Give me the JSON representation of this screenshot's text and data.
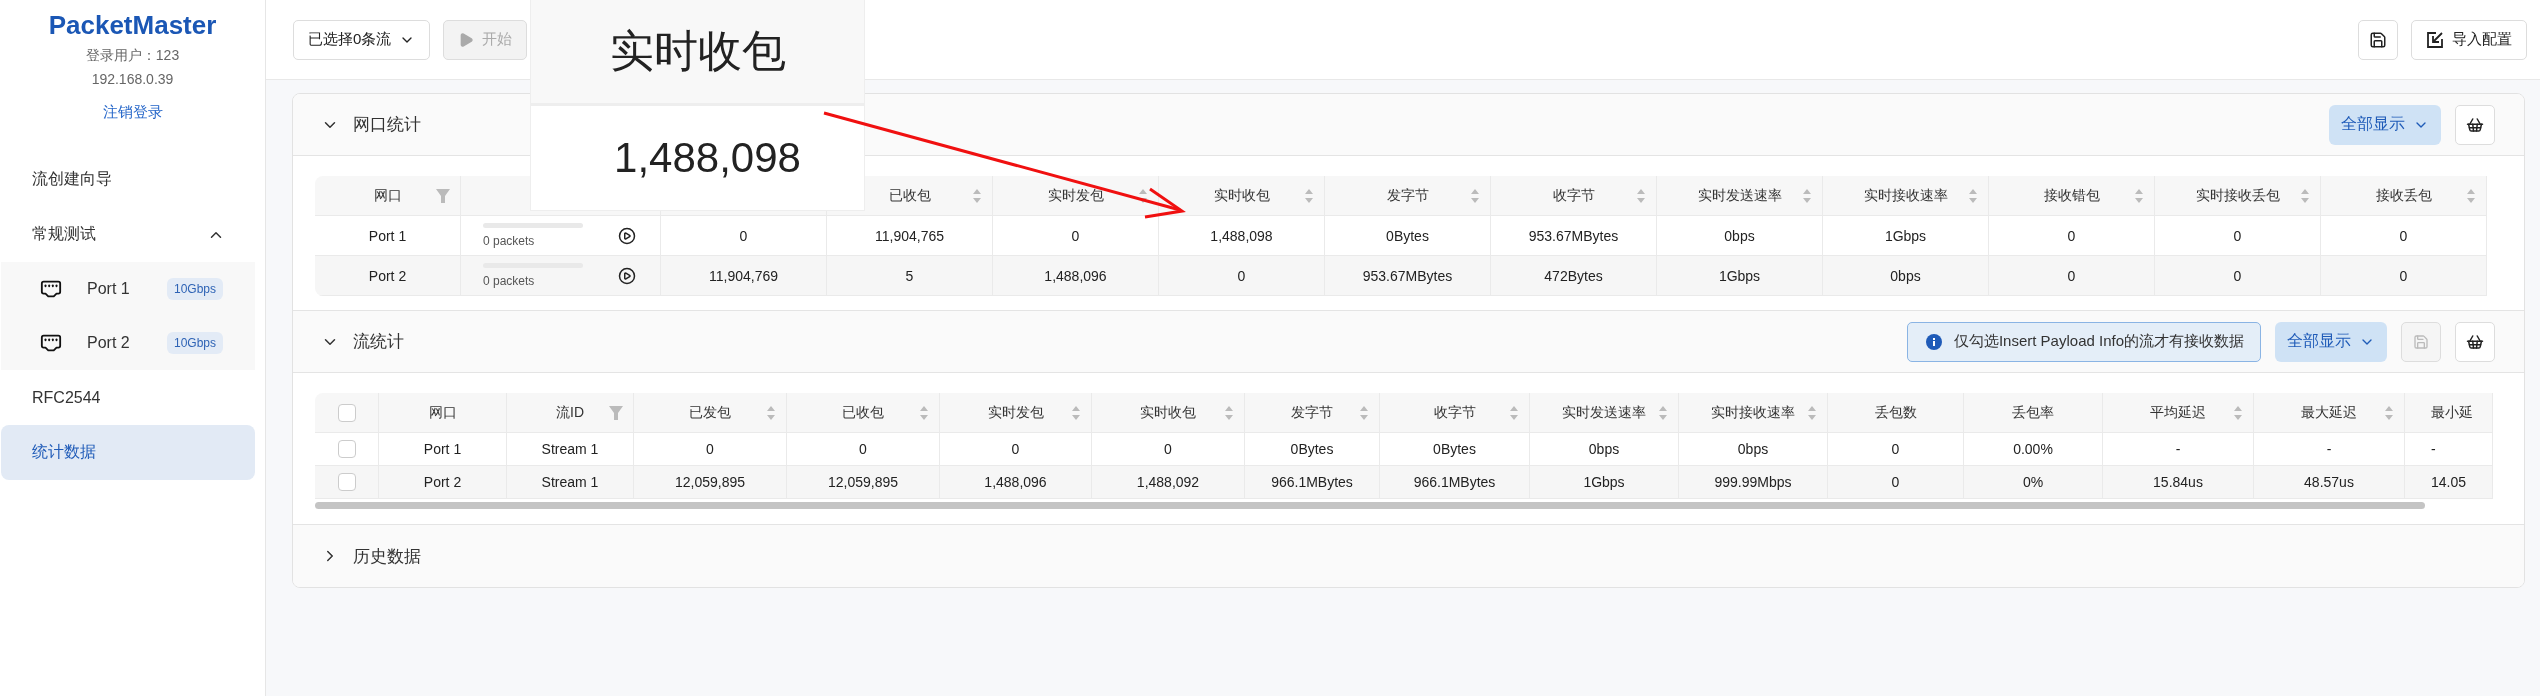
{
  "sidebar": {
    "brand": "PacketMaster",
    "user": "登录用户：123",
    "ip": "192.168.0.39",
    "logout": "注销登录",
    "nav": [
      {
        "kind": "item",
        "label": "流创建向导",
        "selected": false
      },
      {
        "kind": "group",
        "label": "常规测试",
        "selected": false,
        "expanded": true,
        "children": [
          {
            "label": "Port 1",
            "badge": "10Gbps",
            "selected": false
          },
          {
            "label": "Port 2",
            "badge": "10Gbps",
            "selected": false
          }
        ]
      },
      {
        "kind": "item",
        "label": "RFC2544",
        "selected": false
      },
      {
        "kind": "item",
        "label": "统计数据",
        "selected": true
      }
    ]
  },
  "toolbar": {
    "stream_select": "已选择0条流",
    "start": {
      "label": "开始",
      "disabled": true
    },
    "import": "导入配置"
  },
  "port_stats": {
    "title": "网口统计",
    "expanded": true,
    "display_filter": "全部显示",
    "columns": [
      {
        "label": "网口",
        "filter": true
      },
      {},
      {},
      {
        "label": "已收包",
        "sort": true
      },
      {
        "label": "实时发包",
        "sort": true
      },
      {
        "label": "实时收包",
        "sort": true
      },
      {
        "label": "发字节",
        "sort": true
      },
      {
        "label": "收字节",
        "sort": true
      },
      {
        "label": "实时发送速率",
        "sort": true
      },
      {
        "label": "实时接收速率",
        "sort": true
      },
      {
        "label": "接收错包",
        "sort": true
      },
      {
        "label": "实时接收丢包",
        "sort": true
      },
      {
        "label": "接收丢包",
        "sort": true
      }
    ],
    "rows": [
      {
        "port": "Port 1",
        "progress": {
          "level": 0,
          "label": "0 packets"
        },
        "values": [
          "0",
          "11,904,765",
          "0",
          "1,488,098",
          "0Bytes",
          "953.67MBytes",
          "0bps",
          "1Gbps",
          "0",
          "0",
          "0"
        ]
      },
      {
        "port": "Port 2",
        "progress": {
          "level": 0,
          "label": "0 packets"
        },
        "values": [
          "11,904,769",
          "5",
          "1,488,096",
          "0",
          "953.67MBytes",
          "472Bytes",
          "1Gbps",
          "0bps",
          "0",
          "0",
          "0"
        ]
      }
    ]
  },
  "stream_stats": {
    "title": "流统计",
    "expanded": true,
    "notice": "仅勾选Insert Payload Info的流才有接收数据",
    "display_filter": "全部显示",
    "header_checked": false,
    "columns": [
      {
        "label": "网口"
      },
      {
        "label": "流ID",
        "filter": true
      },
      {
        "label": "已发包",
        "sort": true
      },
      {
        "label": "已收包",
        "sort": true
      },
      {
        "label": "实时发包",
        "sort": true
      },
      {
        "label": "实时收包",
        "sort": true
      },
      {
        "label": "发字节",
        "sort": true
      },
      {
        "label": "收字节",
        "sort": true
      },
      {
        "label": "实时发送速率",
        "sort": true
      },
      {
        "label": "实时接收速率",
        "sort": true
      },
      {
        "label": "丢包数"
      },
      {
        "label": "丢包率"
      },
      {
        "label": "平均延迟",
        "sort": true
      },
      {
        "label": "最大延迟",
        "sort": true
      },
      {
        "label": "最小延"
      }
    ],
    "rows": [
      {
        "checked": false,
        "cells": [
          "Port 1",
          "Stream 1",
          "0",
          "0",
          "0",
          "0",
          "0Bytes",
          "0Bytes",
          "0bps",
          "0bps",
          "0",
          "0.00%",
          "-",
          "-",
          "-"
        ]
      },
      {
        "checked": false,
        "cells": [
          "Port 2",
          "Stream 1",
          "12,059,895",
          "12,059,895",
          "1,488,096",
          "1,488,092",
          "966.1MBytes",
          "966.1MBytes",
          "1Gbps",
          "999.99Mbps",
          "0",
          "0%",
          "15.84us",
          "48.57us",
          "14.05"
        ]
      }
    ]
  },
  "history": {
    "title": "历史数据",
    "expanded": false
  },
  "callout": {
    "header": "实时收包",
    "value": "1,488,098"
  }
}
